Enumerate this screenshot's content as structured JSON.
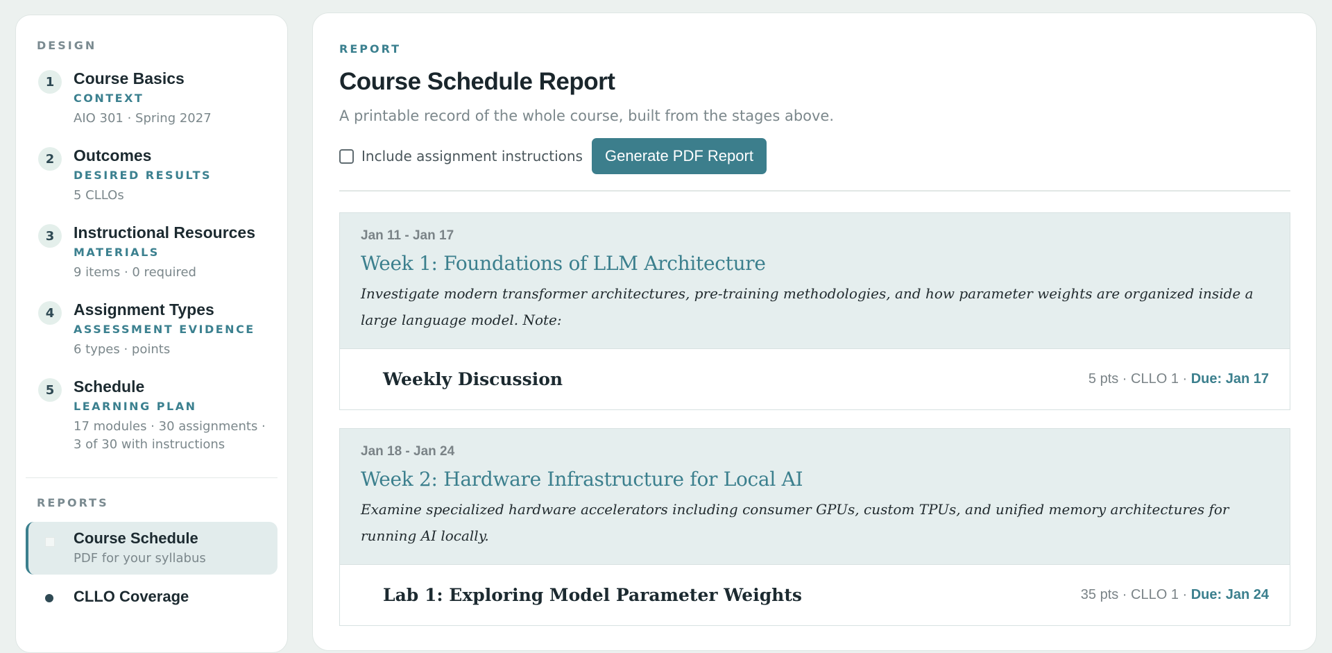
{
  "sidebar": {
    "design_label": "DESIGN",
    "stages": [
      {
        "number": "1",
        "title": "Course Basics",
        "tag": "CONTEXT",
        "meta": "AIO 301 · Spring 2027"
      },
      {
        "number": "2",
        "title": "Outcomes",
        "tag": "DESIRED RESULTS",
        "meta": "5 CLLOs"
      },
      {
        "number": "3",
        "title": "Instructional Resources",
        "tag": "MATERIALS",
        "meta": "9 items · 0 required"
      },
      {
        "number": "4",
        "title": "Assignment Types",
        "tag": "ASSESSMENT EVIDENCE",
        "meta": "6 types · points"
      },
      {
        "number": "5",
        "title": "Schedule",
        "tag": "LEARNING PLAN",
        "meta": "17 modules · 30 assignments · 3 of 30 with instructions"
      }
    ],
    "reports_label": "REPORTS",
    "reports": [
      {
        "title": "Course Schedule",
        "subtitle": "PDF for your syllabus",
        "active": true
      },
      {
        "title": "CLLO Coverage",
        "subtitle": "",
        "active": false
      }
    ]
  },
  "main": {
    "eyebrow": "REPORT",
    "title": "Course Schedule Report",
    "subtitle": "A printable record of the whole course, built from the stages above.",
    "include_instructions_label": "Include assignment instructions",
    "include_instructions_checked": false,
    "generate_button": "Generate PDF Report",
    "weeks": [
      {
        "dates": "Jan 11 - Jan 17",
        "title": "Week 1: Foundations of LLM Architecture",
        "description": "Investigate modern transformer architectures, pre-training methodologies, and how parameter weights are organized inside a large language model. Note:",
        "assignments": [
          {
            "title": "Weekly Discussion",
            "meta": "5 pts · CLLO 1 · ",
            "due": "Due: Jan 17"
          }
        ]
      },
      {
        "dates": "Jan 18 - Jan 24",
        "title": "Week 2: Hardware Infrastructure for Local AI",
        "description": "Examine specialized hardware accelerators including consumer GPUs, custom TPUs, and unified memory architectures for running AI locally.",
        "assignments": [
          {
            "title": "Lab 1: Exploring Model Parameter Weights",
            "meta": "35 pts · CLLO 1 · ",
            "due": "Due: Jan 24"
          }
        ]
      }
    ]
  }
}
